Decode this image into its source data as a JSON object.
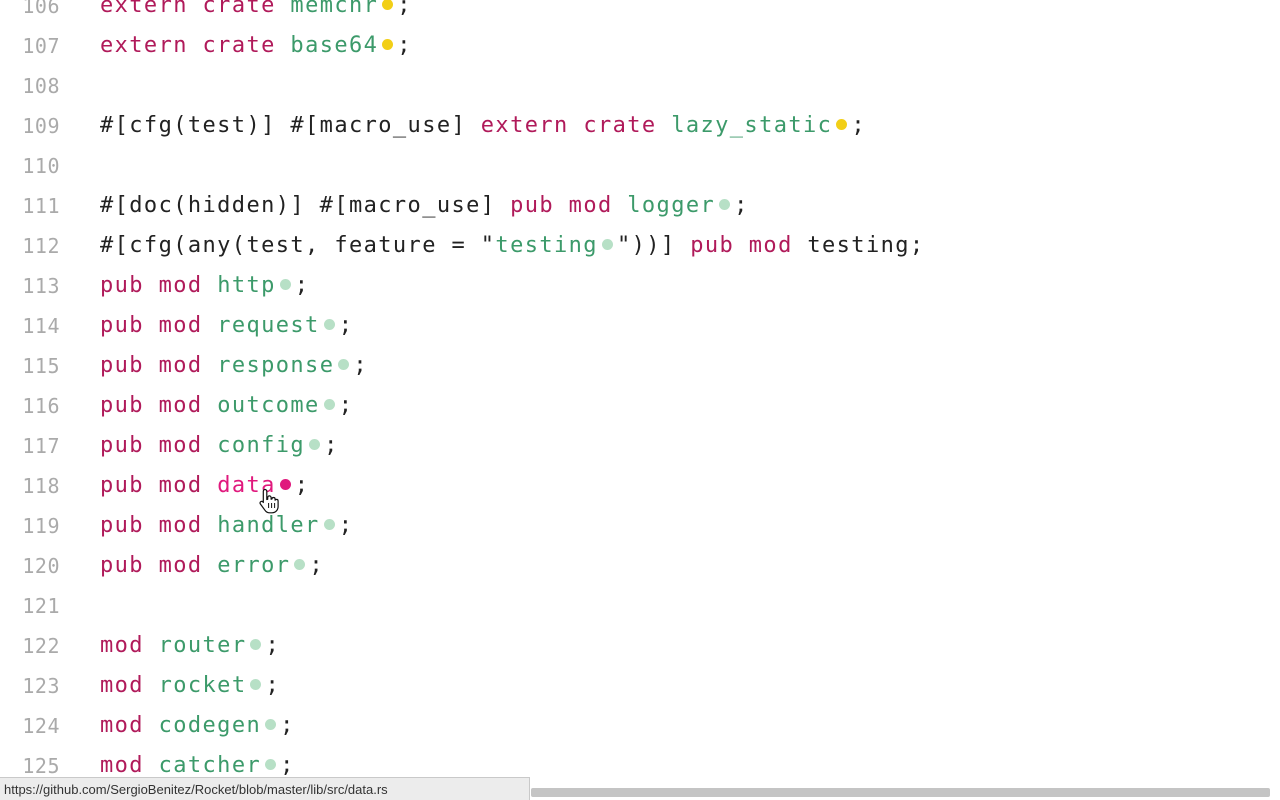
{
  "lines": [
    {
      "no": "106",
      "tokens": [
        {
          "t": "extern",
          "c": "kw"
        },
        {
          "t": " ",
          "c": "pl"
        },
        {
          "t": "crate",
          "c": "kw"
        },
        {
          "t": " ",
          "c": "pl"
        },
        {
          "t": "memchr",
          "c": "id"
        },
        {
          "dot": "yellow"
        },
        {
          "t": ";",
          "c": "pl"
        }
      ]
    },
    {
      "no": "107",
      "tokens": [
        {
          "t": "extern",
          "c": "kw"
        },
        {
          "t": " ",
          "c": "pl"
        },
        {
          "t": "crate",
          "c": "kw"
        },
        {
          "t": " ",
          "c": "pl"
        },
        {
          "t": "base64",
          "c": "id"
        },
        {
          "dot": "yellow"
        },
        {
          "t": ";",
          "c": "pl"
        }
      ]
    },
    {
      "no": "108",
      "tokens": []
    },
    {
      "no": "109",
      "tokens": [
        {
          "t": "#[cfg(test)] #[macro_use] ",
          "c": "pl"
        },
        {
          "t": "extern",
          "c": "kw"
        },
        {
          "t": " ",
          "c": "pl"
        },
        {
          "t": "crate",
          "c": "kw"
        },
        {
          "t": " ",
          "c": "pl"
        },
        {
          "t": "lazy_static",
          "c": "id"
        },
        {
          "dot": "yellow"
        },
        {
          "t": ";",
          "c": "pl"
        }
      ]
    },
    {
      "no": "110",
      "tokens": []
    },
    {
      "no": "111",
      "tokens": [
        {
          "t": "#[doc(hidden)] #[macro_use] ",
          "c": "pl"
        },
        {
          "t": "pub",
          "c": "kw"
        },
        {
          "t": " ",
          "c": "pl"
        },
        {
          "t": "mod",
          "c": "kw"
        },
        {
          "t": " ",
          "c": "pl"
        },
        {
          "t": "logger",
          "c": "id"
        },
        {
          "dot": "green"
        },
        {
          "t": ";",
          "c": "pl"
        }
      ]
    },
    {
      "no": "112",
      "tokens": [
        {
          "t": "#[cfg(any(test, feature = \"",
          "c": "pl"
        },
        {
          "t": "testing",
          "c": "id"
        },
        {
          "dot": "green"
        },
        {
          "t": "\"))] ",
          "c": "pl"
        },
        {
          "t": "pub",
          "c": "kw"
        },
        {
          "t": " ",
          "c": "pl"
        },
        {
          "t": "mod",
          "c": "kw"
        },
        {
          "t": " testing;",
          "c": "pl"
        }
      ]
    },
    {
      "no": "113",
      "tokens": [
        {
          "t": "pub",
          "c": "kw"
        },
        {
          "t": " ",
          "c": "pl"
        },
        {
          "t": "mod",
          "c": "kw"
        },
        {
          "t": " ",
          "c": "pl"
        },
        {
          "t": "http",
          "c": "id"
        },
        {
          "dot": "green"
        },
        {
          "t": ";",
          "c": "pl"
        }
      ]
    },
    {
      "no": "114",
      "tokens": [
        {
          "t": "pub",
          "c": "kw"
        },
        {
          "t": " ",
          "c": "pl"
        },
        {
          "t": "mod",
          "c": "kw"
        },
        {
          "t": " ",
          "c": "pl"
        },
        {
          "t": "request",
          "c": "id"
        },
        {
          "dot": "green"
        },
        {
          "t": ";",
          "c": "pl"
        }
      ]
    },
    {
      "no": "115",
      "tokens": [
        {
          "t": "pub",
          "c": "kw"
        },
        {
          "t": " ",
          "c": "pl"
        },
        {
          "t": "mod",
          "c": "kw"
        },
        {
          "t": " ",
          "c": "pl"
        },
        {
          "t": "response",
          "c": "id"
        },
        {
          "dot": "green"
        },
        {
          "t": ";",
          "c": "pl"
        }
      ]
    },
    {
      "no": "116",
      "tokens": [
        {
          "t": "pub",
          "c": "kw"
        },
        {
          "t": " ",
          "c": "pl"
        },
        {
          "t": "mod",
          "c": "kw"
        },
        {
          "t": " ",
          "c": "pl"
        },
        {
          "t": "outcome",
          "c": "id"
        },
        {
          "dot": "green"
        },
        {
          "t": ";",
          "c": "pl"
        }
      ]
    },
    {
      "no": "117",
      "tokens": [
        {
          "t": "pub",
          "c": "kw"
        },
        {
          "t": " ",
          "c": "pl"
        },
        {
          "t": "mod",
          "c": "kw"
        },
        {
          "t": " ",
          "c": "pl"
        },
        {
          "t": "config",
          "c": "id"
        },
        {
          "dot": "green"
        },
        {
          "t": ";",
          "c": "pl"
        }
      ]
    },
    {
      "no": "118",
      "tokens": [
        {
          "t": "pub",
          "c": "kw"
        },
        {
          "t": " ",
          "c": "pl"
        },
        {
          "t": "mod",
          "c": "kw"
        },
        {
          "t": " ",
          "c": "pl"
        },
        {
          "t": "data",
          "c": "hot"
        },
        {
          "dot": "pink"
        },
        {
          "t": ";",
          "c": "pl"
        }
      ]
    },
    {
      "no": "119",
      "tokens": [
        {
          "t": "pub",
          "c": "kw"
        },
        {
          "t": " ",
          "c": "pl"
        },
        {
          "t": "mod",
          "c": "kw"
        },
        {
          "t": " ",
          "c": "pl"
        },
        {
          "t": "handler",
          "c": "id"
        },
        {
          "dot": "green"
        },
        {
          "t": ";",
          "c": "pl"
        }
      ]
    },
    {
      "no": "120",
      "tokens": [
        {
          "t": "pub",
          "c": "kw"
        },
        {
          "t": " ",
          "c": "pl"
        },
        {
          "t": "mod",
          "c": "kw"
        },
        {
          "t": " ",
          "c": "pl"
        },
        {
          "t": "error",
          "c": "id"
        },
        {
          "dot": "green"
        },
        {
          "t": ";",
          "c": "pl"
        }
      ]
    },
    {
      "no": "121",
      "tokens": []
    },
    {
      "no": "122",
      "tokens": [
        {
          "t": "mod",
          "c": "kw"
        },
        {
          "t": " ",
          "c": "pl"
        },
        {
          "t": "router",
          "c": "id"
        },
        {
          "dot": "green"
        },
        {
          "t": ";",
          "c": "pl"
        }
      ]
    },
    {
      "no": "123",
      "tokens": [
        {
          "t": "mod",
          "c": "kw"
        },
        {
          "t": " ",
          "c": "pl"
        },
        {
          "t": "rocket",
          "c": "id"
        },
        {
          "dot": "green"
        },
        {
          "t": ";",
          "c": "pl"
        }
      ]
    },
    {
      "no": "124",
      "tokens": [
        {
          "t": "mod",
          "c": "kw"
        },
        {
          "t": " ",
          "c": "pl"
        },
        {
          "t": "codegen",
          "c": "id"
        },
        {
          "dot": "green"
        },
        {
          "t": ";",
          "c": "pl"
        }
      ]
    },
    {
      "no": "125",
      "tokens": [
        {
          "t": "mod",
          "c": "kw"
        },
        {
          "t": " ",
          "c": "pl"
        },
        {
          "t": "catcher",
          "c": "id"
        },
        {
          "dot": "green"
        },
        {
          "t": ";",
          "c": "pl"
        }
      ]
    }
  ],
  "status_bar": {
    "url": "https://github.com/SergioBenitez/Rocket/blob/master/lib/src/data.rs"
  },
  "colors": {
    "keyword": "#b01a5a",
    "identifier": "#3c9a6a",
    "hovered": "#e0197d",
    "line_number": "#aaaaaa",
    "dot_yellow": "#f2cf17",
    "dot_green": "#b7e0c6"
  },
  "cursor_icon": "hand-pointer-icon"
}
